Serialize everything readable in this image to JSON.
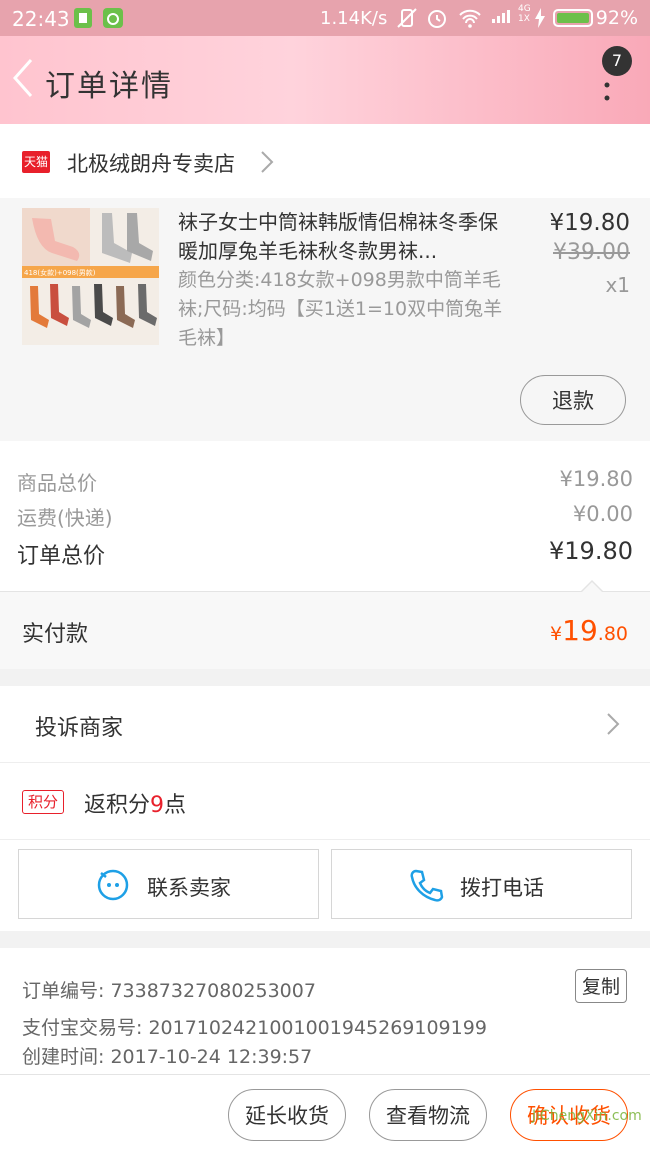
{
  "status_bar": {
    "time": "22:43",
    "speed": "1.14K/s",
    "network": "4G",
    "sim": "1X",
    "battery": "92%"
  },
  "header": {
    "title": "订单详情",
    "badge": "7"
  },
  "store": {
    "name": "北极绒朗舟专卖店",
    "logo_text": "天猫"
  },
  "product": {
    "title": "袜子女士中筒袜韩版情侣棉袜冬季保暖加厚兔羊毛袜秋冬款男袜...",
    "spec": "颜色分类:418女款+098男款中筒羊毛袜;尺码:均码【买1送1=10双中筒兔羊毛袜】",
    "price": "¥19.80",
    "original_price": "¥39.00",
    "quantity": "x1",
    "thumb_caption": "418(女款)+098(男款)",
    "refund_label": "退款"
  },
  "totals": {
    "goods_label": "商品总价",
    "goods_value": "¥19.80",
    "shipping_label": "运费(快递)",
    "shipping_value": "¥0.00",
    "order_label": "订单总价",
    "order_value": "¥19.80",
    "paid_label": "实付款",
    "paid_currency": "¥",
    "paid_int": "19",
    "paid_dec": ".80"
  },
  "complain": {
    "label": "投诉商家"
  },
  "points": {
    "tag": "积分",
    "prefix": "返积分",
    "num": "9",
    "suffix": "点"
  },
  "contact": {
    "seller_label": "联系卖家",
    "phone_label": "拨打电话"
  },
  "order_info": {
    "order_no": "订单编号: 73387327080253007",
    "alipay_no": "支付宝交易号: 2017102421001001945269109199",
    "created": "创建时间: 2017-10-24 12:39:57",
    "copy_label": "复制"
  },
  "bottom": {
    "extend_label": "延长收货",
    "logistics_label": "查看物流",
    "confirm_label": "确认收货"
  },
  "watermark": "JiChengXin.com",
  "colors": {
    "accent": "#ff5000",
    "tmall_red": "#e8202b",
    "header_pink": "#ffc4cf"
  }
}
